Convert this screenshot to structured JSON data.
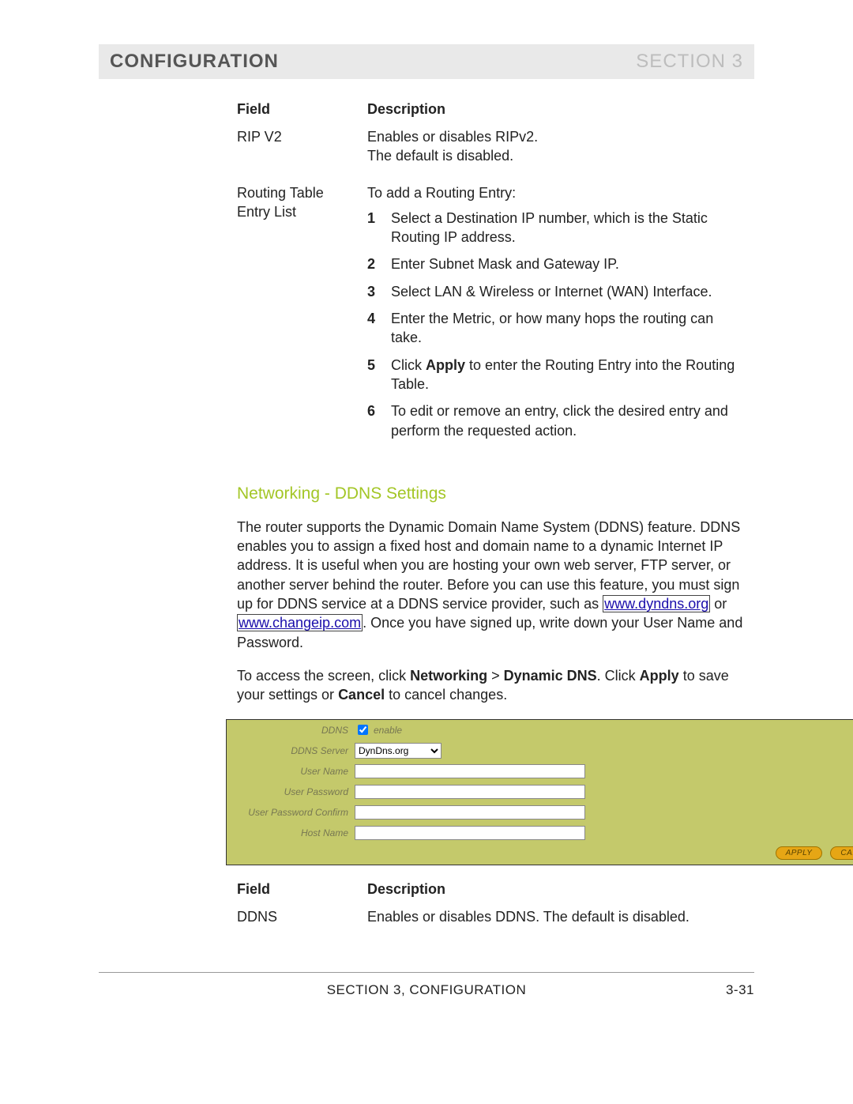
{
  "header": {
    "left": "CONFIGURATION",
    "right": "SECTION 3"
  },
  "table1": {
    "header_field": "Field",
    "header_desc": "Description",
    "rows": [
      {
        "field": "RIP V2",
        "desc_lines": [
          "Enables or disables RIPv2.",
          "The default is disabled."
        ]
      },
      {
        "field": "Routing Table Entry List",
        "intro": "To add a Routing Entry:",
        "steps": [
          "Select a Destination IP number, which is the Static Routing IP address.",
          "Enter Subnet Mask and Gateway IP.",
          "Select LAN & Wireless or Internet (WAN) Interface.",
          "Enter the Metric, or how many hops the routing can take.",
          {
            "pre": "Click ",
            "bold": "Apply",
            "post": " to enter the Routing Entry into the Routing Table."
          },
          "To edit or remove an entry, click the desired entry and perform the requested action."
        ]
      }
    ]
  },
  "section_heading": "Networking - DDNS Settings",
  "para1": {
    "a": "The router supports the Dynamic Domain Name System (DDNS) feature. DDNS enables you to assign a fixed host and domain name to a dynamic Internet IP address. It is useful when you are hosting your own web server, FTP server, or another server behind the router. Before you can use this feature, you must sign up for DDNS service at a DDNS service provider, such as ",
    "link1": "www.dyndns.org",
    "b": " or ",
    "link2": "www.changeip.com",
    "c": ". Once you have signed up, write down your User Name and Password."
  },
  "para2": {
    "a": "To access the screen, click ",
    "b1": "Networking",
    "gt": " > ",
    "b2": "Dynamic DNS",
    "c": ". Click ",
    "b3": "Apply",
    "d": " to save your settings or ",
    "b4": "Cancel",
    "e": " to cancel changes."
  },
  "ddns_form": {
    "labels": {
      "ddns": "DDNS",
      "server": "DDNS Server",
      "user": "User Name",
      "pwd": "User Password",
      "pwdc": "User Password Confirm",
      "host": "Host Name"
    },
    "enable_label": "enable",
    "server_value": "DynDns.org",
    "buttons": {
      "apply": "APPLY",
      "cancel": "CANCEL"
    }
  },
  "table2": {
    "header_field": "Field",
    "header_desc": "Description",
    "row": {
      "field": "DDNS",
      "desc": "Enables or disables DDNS. The default is disabled."
    }
  },
  "footer": {
    "center": "SECTION 3, CONFIGURATION",
    "page": "3-31"
  }
}
